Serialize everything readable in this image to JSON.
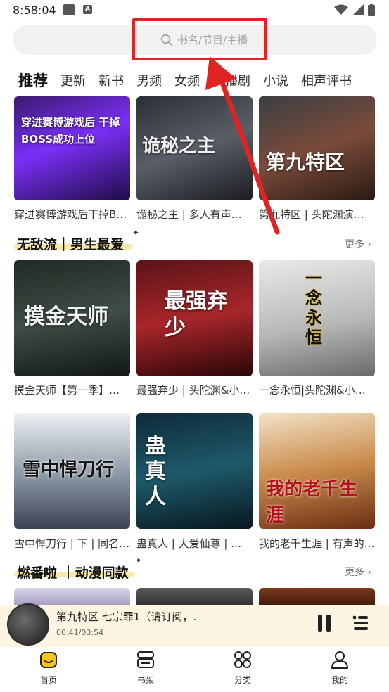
{
  "status_bar": {
    "time": "8:58:04"
  },
  "search": {
    "placeholder": "书名/节目/主播"
  },
  "tabs": [
    "推荐",
    "更新",
    "新书",
    "男频",
    "女频",
    "广播剧",
    "小说",
    "相声评书"
  ],
  "top_row": [
    {
      "title": "穿进赛博游戏后干掉B…",
      "cover_text": "穿进赛博游戏后 干掉BOSS成功上位"
    },
    {
      "title": "诡秘之主 | 多人有声…",
      "cover_text": "诡秘之主"
    },
    {
      "title": "第九特区 | 头陀渊演…",
      "cover_text": "第九特区"
    }
  ],
  "section1": {
    "title": "无敌流｜男生最爱",
    "more": "更多",
    "books": [
      {
        "title": "摸金天师【第一季】…",
        "cover_text": "摸金天师"
      },
      {
        "title": "最强弃少 | 头陀渊&小…",
        "cover_text": "最强弃少"
      },
      {
        "title": "一念永恒|头陀渊&小…",
        "cover_text": "一念永恒"
      },
      {
        "title": "雪中悍刀行 | 下 | 同名…",
        "cover_text": "雪中悍刀行"
      },
      {
        "title": "蛊真人 | 大爱仙尊 | …",
        "cover_text": "蛊真人"
      },
      {
        "title": "我的老千生涯 | 有声的…",
        "cover_text": "我的老千生涯"
      }
    ]
  },
  "section2": {
    "title": "燃番啦 ｜动漫同款",
    "more": "更多"
  },
  "player": {
    "title": "第九特区 七宗罪1（请订阅，…",
    "time": "00:41/03:54"
  },
  "nav": [
    {
      "label": "首页",
      "icon": "home-icon"
    },
    {
      "label": "书架",
      "icon": "bookshelf-icon"
    },
    {
      "label": "分类",
      "icon": "category-icon"
    },
    {
      "label": "我的",
      "icon": "profile-icon"
    }
  ],
  "colors": {
    "accent": "#f5c518",
    "highlight": "#e02424",
    "underline": "#fbe8a6"
  }
}
